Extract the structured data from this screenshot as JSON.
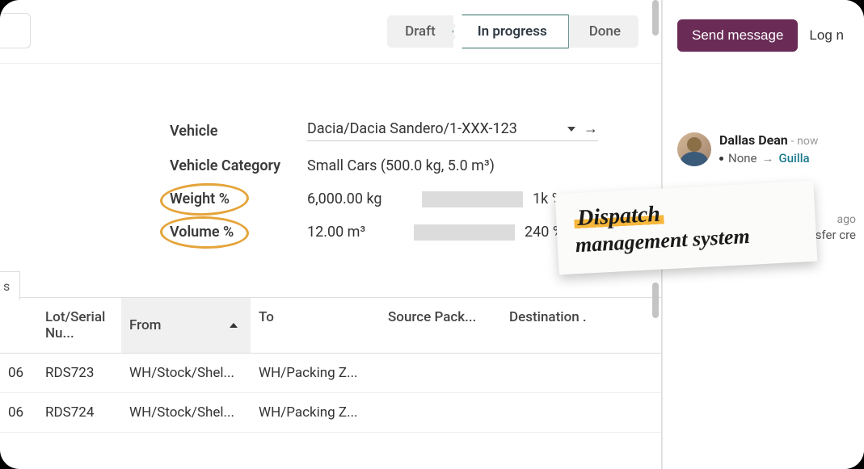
{
  "status": {
    "draft": "Draft",
    "in_progress": "In progress",
    "done": "Done"
  },
  "form": {
    "vehicle_label": "Vehicle",
    "vehicle_value": "Dacia/Dacia Sandero/1-XXX-123",
    "category_label": "Vehicle Category",
    "category_value": "Small Cars (500.0 kg, 5.0 m³)",
    "weight_label": "Weight %",
    "weight_value": "6,000.00 kg",
    "weight_percent": "1k %",
    "volume_label": "Volume %",
    "volume_value": "12.00 m³",
    "volume_percent": "240 %"
  },
  "table": {
    "tab_fragment": "s",
    "headers": {
      "lot": "Lot/Serial Nu...",
      "from": "From",
      "to": "To",
      "source": "Source Pack...",
      "dest": "Destination ."
    },
    "rows": [
      {
        "pre": "06",
        "lot": "RDS723",
        "from": "WH/Stock/Shel...",
        "to": "WH/Packing Z..."
      },
      {
        "pre": "06",
        "lot": "RDS724",
        "from": "WH/Stock/Shel...",
        "to": "WH/Packing Z..."
      }
    ]
  },
  "side": {
    "send": "Send message",
    "log": "Log n",
    "author": "Dallas Dean",
    "time_sep": "-",
    "time": "now",
    "change_from": "None",
    "change_to": "Guilla",
    "trail_time": "ago",
    "trail_text": "ansfer cre"
  },
  "sticky": {
    "line1": "Dispatch",
    "line2": "management system"
  }
}
